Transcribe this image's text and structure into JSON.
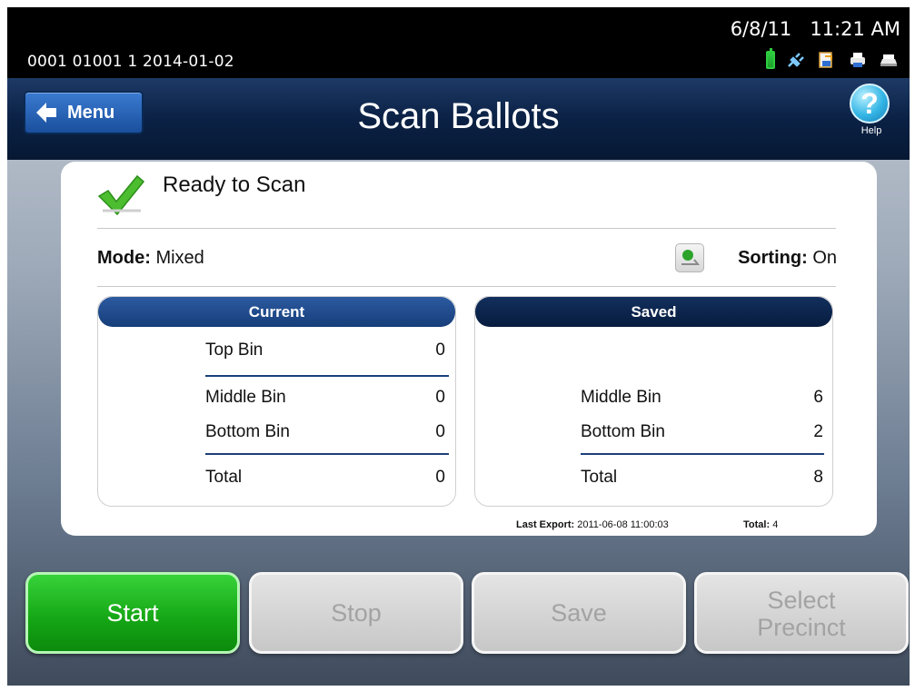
{
  "status_bar": {
    "machine_id": "0001 01001 1   2014-01-02",
    "date": "6/8/11",
    "time": "11:21 AM",
    "icons": [
      "battery-icon",
      "power-plug-icon",
      "document-icon",
      "printer-icon",
      "scanner-icon"
    ]
  },
  "header": {
    "menu_label": "Menu",
    "title": "Scan Ballots",
    "help_glyph": "?",
    "help_label": "Help"
  },
  "status": {
    "ready_text": "Ready to Scan",
    "mode_label": "Mode:",
    "mode_value": "Mixed",
    "sorting_label": "Sorting:",
    "sorting_value": "On"
  },
  "current_panel": {
    "title": "Current",
    "rows": [
      {
        "label": "Top Bin",
        "value": "0"
      },
      {
        "label": "Middle Bin",
        "value": "0"
      },
      {
        "label": "Bottom Bin",
        "value": "0"
      }
    ],
    "total_label": "Total",
    "total_value": "0"
  },
  "saved_panel": {
    "title": "Saved",
    "rows": [
      {
        "label": "Middle Bin",
        "value": "6"
      },
      {
        "label": "Bottom Bin",
        "value": "2"
      }
    ],
    "total_label": "Total",
    "total_value": "8"
  },
  "export": {
    "last_export_label": "Last Export:",
    "last_export_value": "2011-06-08 11:00:03",
    "total_label": "Total:",
    "total_value": "4"
  },
  "buttons": {
    "start": "Start",
    "stop": "Stop",
    "save": "Save",
    "select_precinct_line1": "Select",
    "select_precinct_line2": "Precinct"
  },
  "colors": {
    "accent_green": "#14a514",
    "title_bar": "#0b2145",
    "panel_header": "#163e7a",
    "disabled_text": "#a3a3a3"
  }
}
